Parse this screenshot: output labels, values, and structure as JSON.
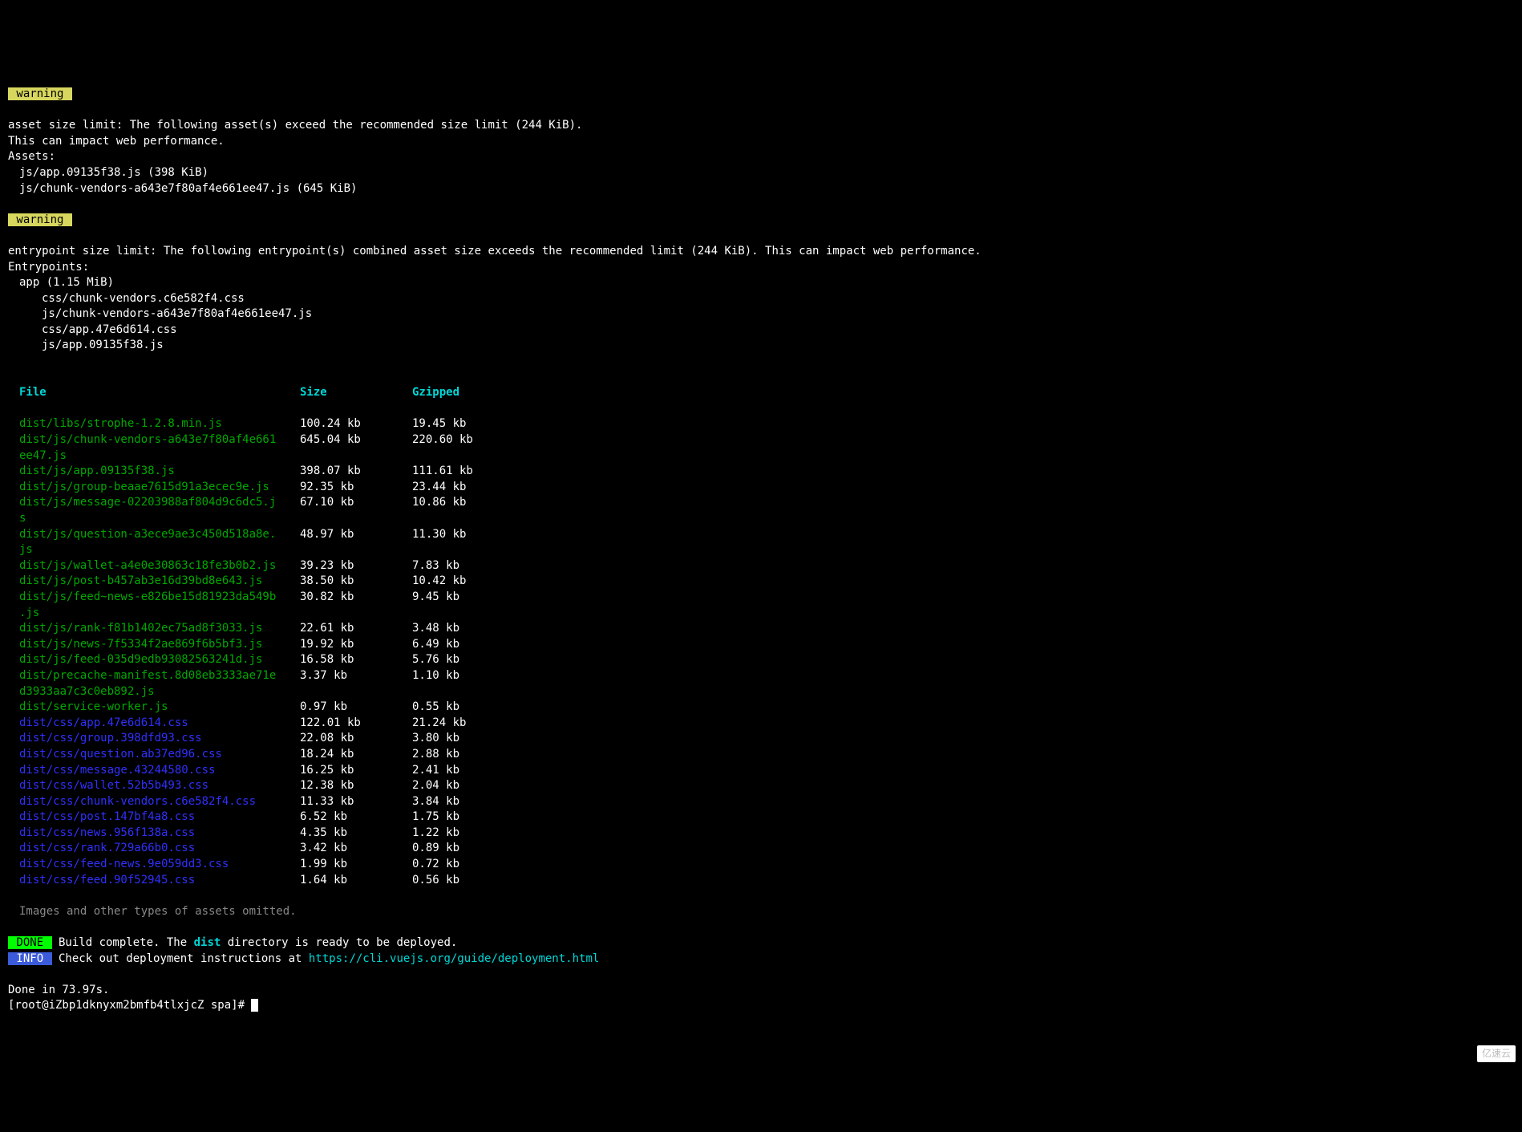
{
  "labels": {
    "warning": " warning ",
    "done": " DONE ",
    "info": " INFO "
  },
  "warning1": {
    "line1": "asset size limit: The following asset(s) exceed the recommended size limit (244 KiB).",
    "line2": "This can impact web performance.",
    "line3": "Assets:",
    "asset1": "js/app.09135f38.js (398 KiB)",
    "asset2": "js/chunk-vendors-a643e7f80af4e661ee47.js (645 KiB)"
  },
  "warning2": {
    "line1": "entrypoint size limit: The following entrypoint(s) combined asset size exceeds the recommended limit (244 KiB). This can impact web performance.",
    "line2": "Entrypoints:",
    "entry": "app (1.15 MiB)",
    "f1": "css/chunk-vendors.c6e582f4.css",
    "f2": "js/chunk-vendors-a643e7f80af4e661ee47.js",
    "f3": "css/app.47e6d614.css",
    "f4": "js/app.09135f38.js"
  },
  "table": {
    "headers": {
      "file": "File",
      "size": "Size",
      "gzipped": "Gzipped"
    },
    "rows": [
      {
        "type": "js",
        "file": "dist/libs/strophe-1.2.8.min.js",
        "size": "100.24 kb",
        "gzip": "19.45 kb"
      },
      {
        "type": "js",
        "file": "dist/js/chunk-vendors-a643e7f80af4e661\nee47.js",
        "size": "645.04 kb",
        "gzip": "220.60 kb"
      },
      {
        "type": "js",
        "file": "dist/js/app.09135f38.js",
        "size": "398.07 kb",
        "gzip": "111.61 kb"
      },
      {
        "type": "js",
        "file": "dist/js/group-beaae7615d91a3ecec9e.js",
        "size": "92.35 kb",
        "gzip": "23.44 kb"
      },
      {
        "type": "js",
        "file": "dist/js/message-02203988af804d9c6dc5.j\ns",
        "size": "67.10 kb",
        "gzip": "10.86 kb"
      },
      {
        "type": "js",
        "file": "dist/js/question-a3ece9ae3c450d518a8e.\njs",
        "size": "48.97 kb",
        "gzip": "11.30 kb"
      },
      {
        "type": "js",
        "file": "dist/js/wallet-a4e0e30863c18fe3b0b2.js",
        "size": "39.23 kb",
        "gzip": "7.83 kb"
      },
      {
        "type": "js",
        "file": "dist/js/post-b457ab3e16d39bd8e643.js",
        "size": "38.50 kb",
        "gzip": "10.42 kb"
      },
      {
        "type": "js",
        "file": "dist/js/feed~news-e826be15d81923da549b\n.js",
        "size": "30.82 kb",
        "gzip": "9.45 kb"
      },
      {
        "type": "js",
        "file": "dist/js/rank-f81b1402ec75ad8f3033.js",
        "size": "22.61 kb",
        "gzip": "3.48 kb"
      },
      {
        "type": "js",
        "file": "dist/js/news-7f5334f2ae869f6b5bf3.js",
        "size": "19.92 kb",
        "gzip": "6.49 kb"
      },
      {
        "type": "js",
        "file": "dist/js/feed-035d9edb93082563241d.js",
        "size": "16.58 kb",
        "gzip": "5.76 kb"
      },
      {
        "type": "js",
        "file": "dist/precache-manifest.8d08eb3333ae71e\nd3933aa7c3c0eb892.js",
        "size": "3.37 kb",
        "gzip": "1.10 kb"
      },
      {
        "type": "js",
        "file": "dist/service-worker.js",
        "size": "0.97 kb",
        "gzip": "0.55 kb"
      },
      {
        "type": "css",
        "file": "dist/css/app.47e6d614.css",
        "size": "122.01 kb",
        "gzip": "21.24 kb"
      },
      {
        "type": "css",
        "file": "dist/css/group.398dfd93.css",
        "size": "22.08 kb",
        "gzip": "3.80 kb"
      },
      {
        "type": "css",
        "file": "dist/css/question.ab37ed96.css",
        "size": "18.24 kb",
        "gzip": "2.88 kb"
      },
      {
        "type": "css",
        "file": "dist/css/message.43244580.css",
        "size": "16.25 kb",
        "gzip": "2.41 kb"
      },
      {
        "type": "css",
        "file": "dist/css/wallet.52b5b493.css",
        "size": "12.38 kb",
        "gzip": "2.04 kb"
      },
      {
        "type": "css",
        "file": "dist/css/chunk-vendors.c6e582f4.css",
        "size": "11.33 kb",
        "gzip": "3.84 kb"
      },
      {
        "type": "css",
        "file": "dist/css/post.147bf4a8.css",
        "size": "6.52 kb",
        "gzip": "1.75 kb"
      },
      {
        "type": "css",
        "file": "dist/css/news.956f138a.css",
        "size": "4.35 kb",
        "gzip": "1.22 kb"
      },
      {
        "type": "css",
        "file": "dist/css/rank.729a66b0.css",
        "size": "3.42 kb",
        "gzip": "0.89 kb"
      },
      {
        "type": "css",
        "file": "dist/css/feed-news.9e059dd3.css",
        "size": "1.99 kb",
        "gzip": "0.72 kb"
      },
      {
        "type": "css",
        "file": "dist/css/feed.90f52945.css",
        "size": "1.64 kb",
        "gzip": "0.56 kb"
      }
    ]
  },
  "foot": {
    "omitted": "Images and other types of assets omitted.",
    "done_pre": " Build complete. The ",
    "done_dir": "dist",
    "done_post": " directory is ready to be deployed.",
    "info_pre": " Check out deployment instructions at ",
    "info_link": "https://cli.vuejs.org/guide/deployment.html",
    "done_time": "Done in 73.97s.",
    "prompt": "[root@iZbp1dknyxm2bmfb4tlxjcZ spa]# "
  },
  "watermark": "亿速云"
}
